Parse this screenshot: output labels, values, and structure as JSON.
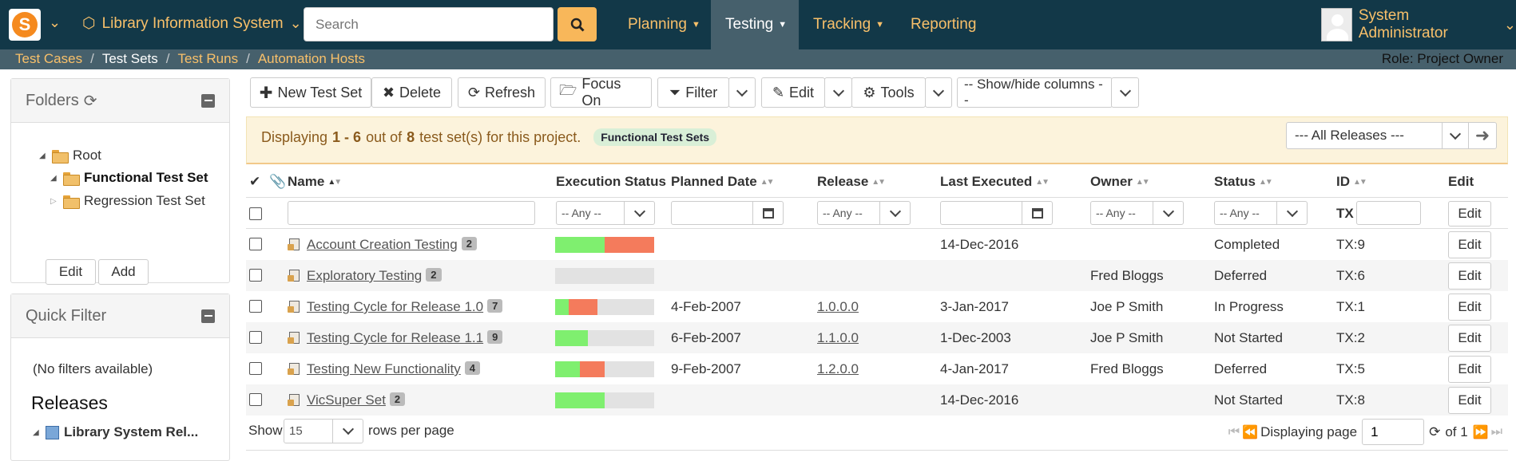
{
  "app": {
    "product_name": "Library Information System",
    "search_placeholder": "Search",
    "menus": [
      "Planning",
      "Testing",
      "Tracking",
      "Reporting"
    ],
    "active_menu": "Testing",
    "user_name": "System Administrator"
  },
  "breadcrumb": {
    "items": [
      "Test Cases",
      "Test Sets",
      "Test Runs",
      "Automation Hosts"
    ],
    "current": "Test Sets",
    "role": "Role: Project Owner"
  },
  "sidebar": {
    "folders_title": "Folders",
    "tree": [
      {
        "label": "Root",
        "expanded": true
      },
      {
        "label": "Functional Test Set",
        "expanded": true,
        "selected": true
      },
      {
        "label": "Regression Test Set",
        "expanded": false
      }
    ],
    "edit_label": "Edit",
    "add_label": "Add",
    "quick_filter_title": "Quick Filter",
    "no_filters": "(No filters available)",
    "releases_title": "Releases",
    "release_item": "Library System Rel..."
  },
  "toolbar": {
    "new_label": "New Test Set",
    "delete_label": "Delete",
    "refresh_label": "Refresh",
    "focus_label": "Focus On",
    "filter_label": "Filter",
    "edit_label": "Edit",
    "tools_label": "Tools",
    "columns_label": "-- Show/hide columns --"
  },
  "info": {
    "prefix": "Displaying",
    "range": "1 - 6",
    "out_of": "out of",
    "total": "8",
    "suffix": "test set(s) for this project.",
    "folder_pill": "Functional Test Sets",
    "release_filter": "--- All Releases ---"
  },
  "columns": {
    "name": "Name",
    "execution_status": "Execution Status",
    "planned_date": "Planned Date",
    "release": "Release",
    "last_executed": "Last Executed",
    "owner": "Owner",
    "status": "Status",
    "id": "ID",
    "edit": "Edit"
  },
  "filters": {
    "any": "-- Any --",
    "id_prefix": "TX",
    "edit_label": "Edit"
  },
  "rows": [
    {
      "name": "Account Creation Testing",
      "count": "2",
      "exec": {
        "pass": 0.5,
        "fail": 0.5
      },
      "planned": "",
      "release": "",
      "last": "14-Dec-2016",
      "owner": "",
      "status": "Completed",
      "id": "TX:9",
      "edit": "Edit"
    },
    {
      "name": "Exploratory Testing",
      "count": "2",
      "exec": {
        "pass": 0,
        "fail": 0
      },
      "planned": "",
      "release": "",
      "last": "",
      "owner": "Fred Bloggs",
      "status": "Deferred",
      "id": "TX:6",
      "edit": "Edit"
    },
    {
      "name": "Testing Cycle for Release 1.0",
      "count": "7",
      "exec": {
        "pass": 0.14,
        "fail": 0.29
      },
      "planned": "4-Feb-2007",
      "release": "1.0.0.0",
      "last": "3-Jan-2017",
      "owner": "Joe P Smith",
      "status": "In Progress",
      "id": "TX:1",
      "edit": "Edit"
    },
    {
      "name": "Testing Cycle for Release 1.1",
      "count": "9",
      "exec": {
        "pass": 0.33,
        "fail": 0
      },
      "planned": "6-Feb-2007",
      "release": "1.1.0.0",
      "last": "1-Dec-2003",
      "owner": "Joe P Smith",
      "status": "Not Started",
      "id": "TX:2",
      "edit": "Edit"
    },
    {
      "name": "Testing New Functionality",
      "count": "4",
      "exec": {
        "pass": 0.25,
        "fail": 0.25
      },
      "planned": "9-Feb-2007",
      "release": "1.2.0.0",
      "last": "4-Jan-2017",
      "owner": "Fred Bloggs",
      "status": "Deferred",
      "id": "TX:5",
      "edit": "Edit"
    },
    {
      "name": "VicSuper Set",
      "count": "2",
      "exec": {
        "pass": 0.5,
        "fail": 0
      },
      "planned": "",
      "release": "",
      "last": "14-Dec-2016",
      "owner": "",
      "status": "Not Started",
      "id": "TX:8",
      "edit": "Edit"
    }
  ],
  "footer": {
    "show_label": "Show",
    "rows_value": "15",
    "rows_suffix": "rows per page",
    "displaying_page": "Displaying page",
    "page_value": "1",
    "of_label": "of 1"
  },
  "colors": {
    "nav_bg": "#123848",
    "accent": "#f8c06a",
    "pass": "#7fef6f",
    "fail": "#f47b5c"
  }
}
